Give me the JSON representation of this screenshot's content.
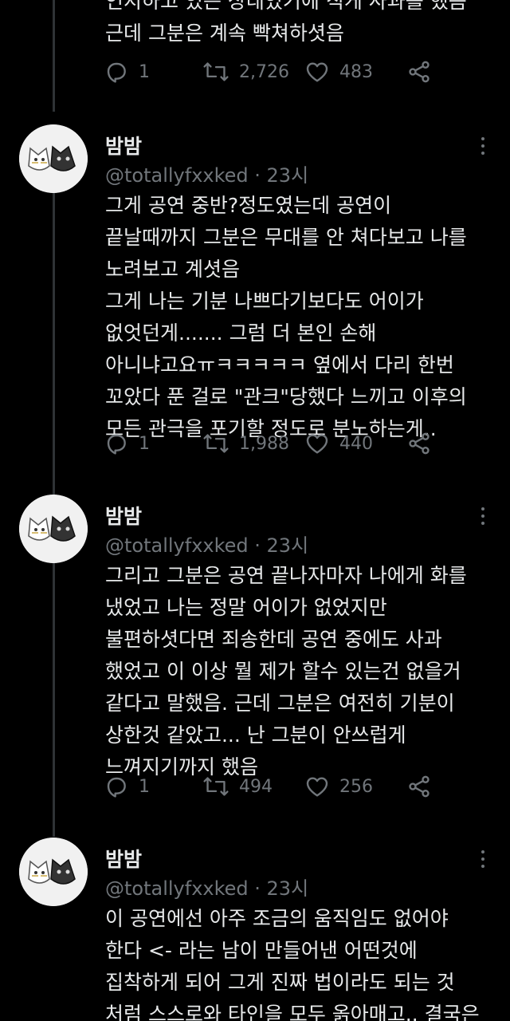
{
  "tweets": [
    {
      "name": "",
      "handle": "",
      "lines": [
        "인지하고 있는 상태였기에 직게 사과를 했음",
        "근데 그분은 계속 빡쳐하셧음"
      ],
      "replies": "1",
      "retweets": "2,726",
      "likes": "483"
    },
    {
      "name": "밤밤",
      "handle": "@totallyfxxked · 23시",
      "lines": [
        "그게 공연 중반?정도였는데 공연이",
        "끝날때까지 그분은 무대를 안 쳐다보고 나를",
        "노려보고 계셧음",
        "그게 나는 기분 나쁘다기보다도 어이가",
        "없엇던게....... 그럼 더 본인 손해",
        "아니냐고요ㅠㅋㅋㅋㅋㅋ 옆에서 다리 한번",
        "꼬았다 푼 걸로 \"관크\"당했다 느끼고 이후의",
        "모든 관극을 포기할 정도로 분노하는게.."
      ],
      "replies": "1",
      "retweets": "1,988",
      "likes": "440"
    },
    {
      "name": "밤밤",
      "handle": "@totallyfxxked · 23시",
      "lines": [
        "그리고 그분은 공연 끝나자마자 나에게 화를",
        "냈었고 나는 정말 어이가 없었지만",
        "불편하셧다면 죄송한데 공연 중에도 사과",
        "했었고 이 이상 뭘 제가 할수 있는건 없을거",
        "같다고 말했음. 근데 그분은 여전히 기분이",
        "상한것 같았고... 난 그분이 안쓰럽게",
        "느껴지기까지 했음"
      ],
      "replies": "1",
      "retweets": "494",
      "likes": "256"
    },
    {
      "name": "밤밤",
      "handle": "@totallyfxxked · 23시",
      "lines": [
        "이 공연에선 아주 조금의 움직임도 없어야",
        "한다 <- 라는 남이 만들어낸 어떤것에",
        "집착하게 되어 그게 진짜 법이라도 되는 것",
        "처럼 스스로와 타인을 모두 옭아매고.. 결국은"
      ]
    }
  ],
  "icons": {
    "reply": "reply-icon",
    "retweet": "retweet-icon",
    "like": "heart-icon",
    "share": "share-icon",
    "more": "more-icon",
    "avatar": "cat-avatar"
  },
  "colors": {
    "background": "#000000",
    "text": "#e7e9ea",
    "secondary": "#71767b",
    "thread_line": "#2f3336"
  }
}
